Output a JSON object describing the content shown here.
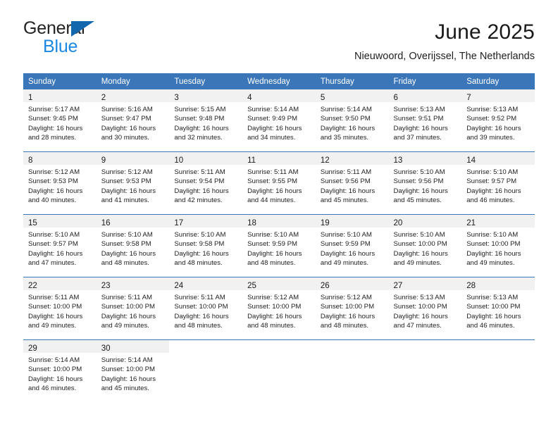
{
  "brand": {
    "line1": "General",
    "line2": "Blue",
    "triangle_color": "#1368ad",
    "blue_text_color": "#1b87e0"
  },
  "header": {
    "title": "June 2025",
    "subtitle": "Nieuwoord, Overijssel, The Netherlands",
    "header_bg_color": "#3a76b8",
    "daynum_band_color": "#f1f1f1"
  },
  "weekdays": [
    "Sunday",
    "Monday",
    "Tuesday",
    "Wednesday",
    "Thursday",
    "Friday",
    "Saturday"
  ],
  "weeks": [
    [
      {
        "day": "1",
        "sunrise": "Sunrise: 5:17 AM",
        "sunset": "Sunset: 9:45 PM",
        "daylight_line1": "Daylight: 16 hours",
        "daylight_line2": "and 28 minutes."
      },
      {
        "day": "2",
        "sunrise": "Sunrise: 5:16 AM",
        "sunset": "Sunset: 9:47 PM",
        "daylight_line1": "Daylight: 16 hours",
        "daylight_line2": "and 30 minutes."
      },
      {
        "day": "3",
        "sunrise": "Sunrise: 5:15 AM",
        "sunset": "Sunset: 9:48 PM",
        "daylight_line1": "Daylight: 16 hours",
        "daylight_line2": "and 32 minutes."
      },
      {
        "day": "4",
        "sunrise": "Sunrise: 5:14 AM",
        "sunset": "Sunset: 9:49 PM",
        "daylight_line1": "Daylight: 16 hours",
        "daylight_line2": "and 34 minutes."
      },
      {
        "day": "5",
        "sunrise": "Sunrise: 5:14 AM",
        "sunset": "Sunset: 9:50 PM",
        "daylight_line1": "Daylight: 16 hours",
        "daylight_line2": "and 35 minutes."
      },
      {
        "day": "6",
        "sunrise": "Sunrise: 5:13 AM",
        "sunset": "Sunset: 9:51 PM",
        "daylight_line1": "Daylight: 16 hours",
        "daylight_line2": "and 37 minutes."
      },
      {
        "day": "7",
        "sunrise": "Sunrise: 5:13 AM",
        "sunset": "Sunset: 9:52 PM",
        "daylight_line1": "Daylight: 16 hours",
        "daylight_line2": "and 39 minutes."
      }
    ],
    [
      {
        "day": "8",
        "sunrise": "Sunrise: 5:12 AM",
        "sunset": "Sunset: 9:53 PM",
        "daylight_line1": "Daylight: 16 hours",
        "daylight_line2": "and 40 minutes."
      },
      {
        "day": "9",
        "sunrise": "Sunrise: 5:12 AM",
        "sunset": "Sunset: 9:53 PM",
        "daylight_line1": "Daylight: 16 hours",
        "daylight_line2": "and 41 minutes."
      },
      {
        "day": "10",
        "sunrise": "Sunrise: 5:11 AM",
        "sunset": "Sunset: 9:54 PM",
        "daylight_line1": "Daylight: 16 hours",
        "daylight_line2": "and 42 minutes."
      },
      {
        "day": "11",
        "sunrise": "Sunrise: 5:11 AM",
        "sunset": "Sunset: 9:55 PM",
        "daylight_line1": "Daylight: 16 hours",
        "daylight_line2": "and 44 minutes."
      },
      {
        "day": "12",
        "sunrise": "Sunrise: 5:11 AM",
        "sunset": "Sunset: 9:56 PM",
        "daylight_line1": "Daylight: 16 hours",
        "daylight_line2": "and 45 minutes."
      },
      {
        "day": "13",
        "sunrise": "Sunrise: 5:10 AM",
        "sunset": "Sunset: 9:56 PM",
        "daylight_line1": "Daylight: 16 hours",
        "daylight_line2": "and 45 minutes."
      },
      {
        "day": "14",
        "sunrise": "Sunrise: 5:10 AM",
        "sunset": "Sunset: 9:57 PM",
        "daylight_line1": "Daylight: 16 hours",
        "daylight_line2": "and 46 minutes."
      }
    ],
    [
      {
        "day": "15",
        "sunrise": "Sunrise: 5:10 AM",
        "sunset": "Sunset: 9:57 PM",
        "daylight_line1": "Daylight: 16 hours",
        "daylight_line2": "and 47 minutes."
      },
      {
        "day": "16",
        "sunrise": "Sunrise: 5:10 AM",
        "sunset": "Sunset: 9:58 PM",
        "daylight_line1": "Daylight: 16 hours",
        "daylight_line2": "and 48 minutes."
      },
      {
        "day": "17",
        "sunrise": "Sunrise: 5:10 AM",
        "sunset": "Sunset: 9:58 PM",
        "daylight_line1": "Daylight: 16 hours",
        "daylight_line2": "and 48 minutes."
      },
      {
        "day": "18",
        "sunrise": "Sunrise: 5:10 AM",
        "sunset": "Sunset: 9:59 PM",
        "daylight_line1": "Daylight: 16 hours",
        "daylight_line2": "and 48 minutes."
      },
      {
        "day": "19",
        "sunrise": "Sunrise: 5:10 AM",
        "sunset": "Sunset: 9:59 PM",
        "daylight_line1": "Daylight: 16 hours",
        "daylight_line2": "and 49 minutes."
      },
      {
        "day": "20",
        "sunrise": "Sunrise: 5:10 AM",
        "sunset": "Sunset: 10:00 PM",
        "daylight_line1": "Daylight: 16 hours",
        "daylight_line2": "and 49 minutes."
      },
      {
        "day": "21",
        "sunrise": "Sunrise: 5:10 AM",
        "sunset": "Sunset: 10:00 PM",
        "daylight_line1": "Daylight: 16 hours",
        "daylight_line2": "and 49 minutes."
      }
    ],
    [
      {
        "day": "22",
        "sunrise": "Sunrise: 5:11 AM",
        "sunset": "Sunset: 10:00 PM",
        "daylight_line1": "Daylight: 16 hours",
        "daylight_line2": "and 49 minutes."
      },
      {
        "day": "23",
        "sunrise": "Sunrise: 5:11 AM",
        "sunset": "Sunset: 10:00 PM",
        "daylight_line1": "Daylight: 16 hours",
        "daylight_line2": "and 49 minutes."
      },
      {
        "day": "24",
        "sunrise": "Sunrise: 5:11 AM",
        "sunset": "Sunset: 10:00 PM",
        "daylight_line1": "Daylight: 16 hours",
        "daylight_line2": "and 48 minutes."
      },
      {
        "day": "25",
        "sunrise": "Sunrise: 5:12 AM",
        "sunset": "Sunset: 10:00 PM",
        "daylight_line1": "Daylight: 16 hours",
        "daylight_line2": "and 48 minutes."
      },
      {
        "day": "26",
        "sunrise": "Sunrise: 5:12 AM",
        "sunset": "Sunset: 10:00 PM",
        "daylight_line1": "Daylight: 16 hours",
        "daylight_line2": "and 48 minutes."
      },
      {
        "day": "27",
        "sunrise": "Sunrise: 5:13 AM",
        "sunset": "Sunset: 10:00 PM",
        "daylight_line1": "Daylight: 16 hours",
        "daylight_line2": "and 47 minutes."
      },
      {
        "day": "28",
        "sunrise": "Sunrise: 5:13 AM",
        "sunset": "Sunset: 10:00 PM",
        "daylight_line1": "Daylight: 16 hours",
        "daylight_line2": "and 46 minutes."
      }
    ],
    [
      {
        "day": "29",
        "sunrise": "Sunrise: 5:14 AM",
        "sunset": "Sunset: 10:00 PM",
        "daylight_line1": "Daylight: 16 hours",
        "daylight_line2": "and 46 minutes."
      },
      {
        "day": "30",
        "sunrise": "Sunrise: 5:14 AM",
        "sunset": "Sunset: 10:00 PM",
        "daylight_line1": "Daylight: 16 hours",
        "daylight_line2": "and 45 minutes."
      },
      {
        "day": "",
        "sunrise": "",
        "sunset": "",
        "daylight_line1": "",
        "daylight_line2": ""
      },
      {
        "day": "",
        "sunrise": "",
        "sunset": "",
        "daylight_line1": "",
        "daylight_line2": ""
      },
      {
        "day": "",
        "sunrise": "",
        "sunset": "",
        "daylight_line1": "",
        "daylight_line2": ""
      },
      {
        "day": "",
        "sunrise": "",
        "sunset": "",
        "daylight_line1": "",
        "daylight_line2": ""
      },
      {
        "day": "",
        "sunrise": "",
        "sunset": "",
        "daylight_line1": "",
        "daylight_line2": ""
      }
    ]
  ]
}
